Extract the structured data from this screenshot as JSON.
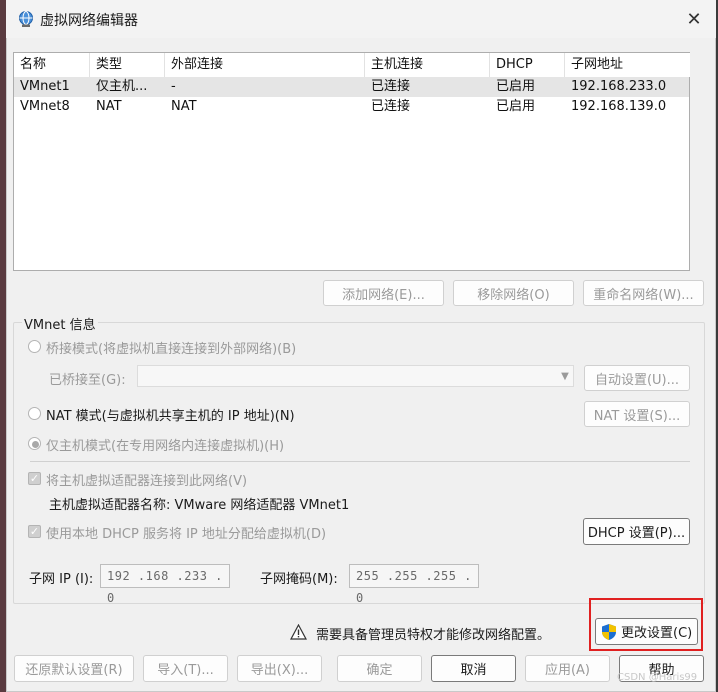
{
  "window": {
    "title": "虚拟网络编辑器",
    "close": "✕"
  },
  "table": {
    "columns": [
      "名称",
      "类型",
      "外部连接",
      "主机连接",
      "DHCP",
      "子网地址"
    ],
    "rows": [
      [
        "VMnet1",
        "仅主机...",
        "-",
        "已连接",
        "已启用",
        "192.168.233.0"
      ],
      [
        "VMnet8",
        "NAT",
        "NAT",
        "已连接",
        "已启用",
        "192.168.139.0"
      ]
    ]
  },
  "network_buttons": {
    "add": "添加网络(E)...",
    "remove": "移除网络(O)",
    "rename": "重命名网络(W)..."
  },
  "vmnet_info": {
    "label": "VMnet 信息",
    "bridged": "桥接模式(将虚拟机直接连接到外部网络)(B)",
    "bridged_to": "已桥接至(G):",
    "auto_settings": "自动设置(U)...",
    "nat": "NAT 模式(与虚拟机共享主机的 IP 地址)(N)",
    "nat_settings": "NAT 设置(S)...",
    "host_only": "仅主机模式(在专用网络内连接虚拟机)(H)",
    "connect_adapter": "将主机虚拟适配器连接到此网络(V)",
    "adapter_name": "主机虚拟适配器名称: VMware 网络适配器 VMnet1",
    "dhcp_service": "使用本地 DHCP 服务将 IP 地址分配给虚拟机(D)",
    "dhcp_settings": "DHCP 设置(P)...",
    "subnet_ip_label": "子网 IP (I):",
    "subnet_ip": "192 .168 .233 .  0",
    "subnet_mask_label": "子网掩码(M):",
    "subnet_mask": "255 .255 .255 .  0"
  },
  "admin_notice": "需要具备管理员特权才能修改网络配置。",
  "change_settings": "更改设置(C)",
  "footer": {
    "restore": "还原默认设置(R)",
    "import": "导入(T)...",
    "export": "导出(X)...",
    "ok": "确定",
    "cancel": "取消",
    "apply": "应用(A)",
    "help": "帮助"
  },
  "watermark": "CSDN @Haris99",
  "colors": {
    "highlight": "#e02020",
    "shield_blue": "#1d6fd1",
    "shield_yellow": "#f2c200"
  }
}
